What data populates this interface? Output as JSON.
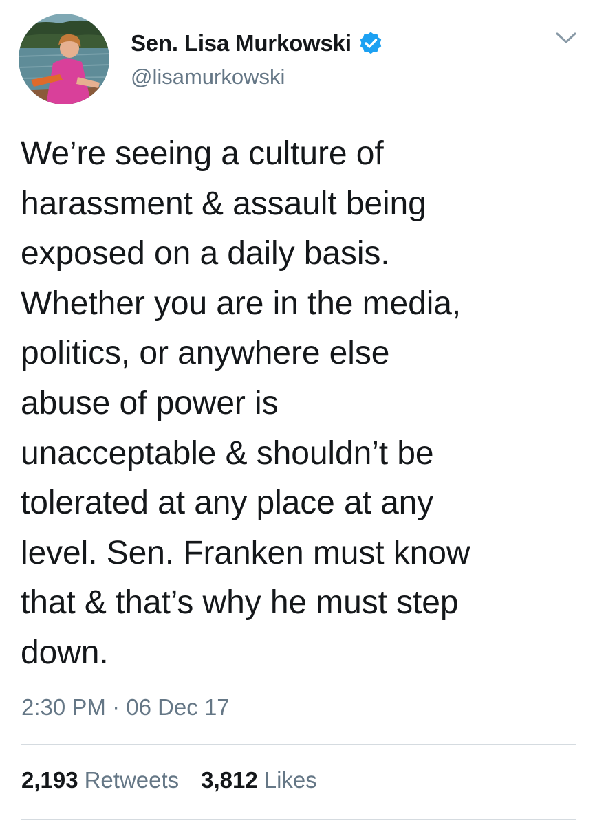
{
  "tweet": {
    "author": {
      "display_name": "Sen. Lisa Murkowski",
      "handle": "@lisamurkowski",
      "verified": true
    },
    "text": "We’re seeing a culture of\nharassment & assault being\nexposed on a daily basis.\nWhether you are in the media,\npolitics, or anywhere else\nabuse of power is\nunacceptable & shouldn’t be\ntolerated at any place at any\nlevel. Sen. Franken must know\nthat & that’s why he must step\ndown.",
    "timestamp": "2:30 PM · 06 Dec 17",
    "stats": {
      "retweets_count": "2,193",
      "retweets_label": "Retweets",
      "likes_count": "3,812",
      "likes_label": "Likes"
    }
  },
  "icons": {
    "verified": "verified-badge-icon",
    "menu": "chevron-down-icon"
  },
  "colors": {
    "text_primary": "#14171a",
    "text_secondary": "#657786",
    "verified_blue": "#1da1f2",
    "divider": "#d5dbe0",
    "background": "#ffffff"
  }
}
